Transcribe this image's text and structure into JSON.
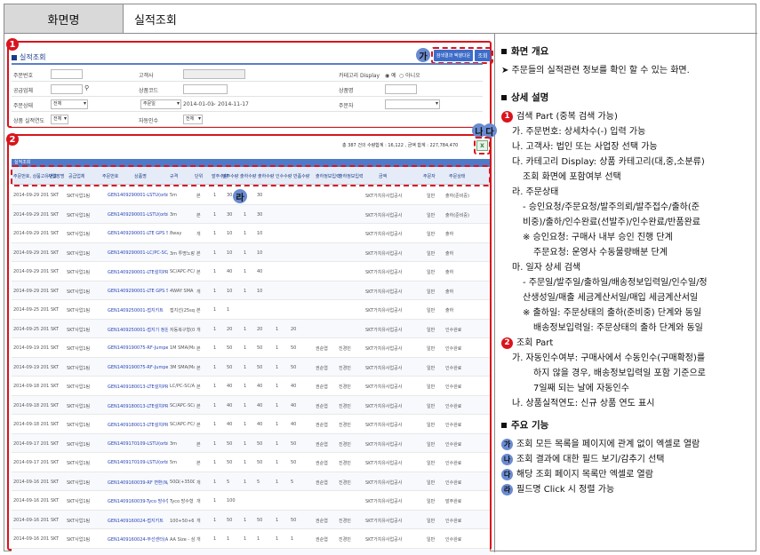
{
  "header": {
    "label": "화면명",
    "title": "실적조회"
  },
  "search": {
    "title": "실적조회",
    "excel_button": "검색결과 엑셀다운",
    "search_button": "조회",
    "fields": {
      "order_no": "주문번호",
      "customer": "고객사",
      "category_display": "카테고리 Display",
      "category_opt_yes": "예",
      "category_opt_no": "아니오",
      "supplier": "공급업체",
      "product_code": "상품코드",
      "product_name": "상품명",
      "order_status": "주문상태",
      "order_status_value": "전체",
      "date_type_value": "주문일",
      "date_from": "2014-01-01",
      "date_to": "2014-11-17",
      "orderer": "주문자",
      "product_year": "상품 실적연도",
      "product_year_value": "전체",
      "auto_receipt": "자동인수",
      "auto_receipt_value": "전체"
    },
    "result_summary": "총 387 건의 수량합계 : 16,122 , 금액 합계 : 227,784,470"
  },
  "grid": {
    "title": "실적조회",
    "columns": [
      "주문번호, 상품고유번호",
      "사업장명",
      "공급업체",
      "주문번호",
      "상품명",
      "규격",
      "단위",
      "발주수량",
      "발주수량",
      "출하수량",
      "출하수량",
      "인수수량",
      "반품수량",
      "출하정보입력",
      "출하정보입력",
      "금액",
      "주문자",
      "주문상태"
    ],
    "rows": [
      {
        "date": "2014-09-29 2014-10-04",
        "site": "SKT",
        "sup": "SKT사업1팀",
        "code": "GEN1409290001-LSTU(orbit)DLC L",
        "name": "5m",
        "unit": "본",
        "q1": "1",
        "q2": "30",
        "q3": "1",
        "q4": "30",
        "q5": "",
        "q6": "",
        "d1": "",
        "d2": "",
        "amt": "SKT가치유사업공사",
        "user": "일반",
        "st": "출하(준비중)"
      },
      {
        "date": "2014-09-29 2014-10-04",
        "site": "SKT",
        "sup": "SKT사업1팀",
        "code": "GEN1409290001-LSTU(orbit)DLC L",
        "name": "3m",
        "unit": "본",
        "q1": "1",
        "q2": "30",
        "q3": "1",
        "q4": "30",
        "q5": "",
        "q6": "",
        "d1": "",
        "d2": "",
        "amt": "SKT가치유사업공사",
        "user": "일반",
        "st": "출하(준비중)"
      },
      {
        "date": "2014-09-29 2014-10-04",
        "site": "SKT",
        "sup": "SKT사업1팀",
        "code": "GEN1409290001-LTE GPS Splitter",
        "name": "8way",
        "unit": "개",
        "q1": "1",
        "q2": "10",
        "q3": "1",
        "q4": "10",
        "q5": "",
        "q6": "",
        "d1": "",
        "d2": "",
        "amt": "SKT가치유사업공사",
        "user": "일반",
        "st": "출하"
      },
      {
        "date": "2014-09-29 2014-10-04",
        "site": "SKT",
        "sup": "SKT사업1팀",
        "code": "GEN1409290001-LC/PC-SC/APC",
        "name": "3m 투명노랑색",
        "unit": "본",
        "q1": "1",
        "q2": "10",
        "q3": "1",
        "q4": "10",
        "q5": "",
        "q6": "",
        "d1": "",
        "d2": "",
        "amt": "SKT가치유사업공사",
        "user": "일반",
        "st": "출하"
      },
      {
        "date": "2014-09-29 2014-10-04",
        "site": "SKT",
        "sup": "SKT사업1팀",
        "code": "GEN1409290001-LTE설치PR수료",
        "name": "SC/APC-FC/APC",
        "unit": "본",
        "q1": "1",
        "q2": "40",
        "q3": "1",
        "q4": "40",
        "q5": "",
        "q6": "",
        "d1": "",
        "d2": "",
        "amt": "SKT가치유사업공사",
        "user": "일반",
        "st": "출하"
      },
      {
        "date": "2014-09-29 2014-10-04",
        "site": "SKT",
        "sup": "SKT사업1팀",
        "code": "GEN1409290001-LTE GPS SPLITTER",
        "name": "4WAY SMA TYPE",
        "unit": "개",
        "q1": "1",
        "q2": "10",
        "q3": "1",
        "q4": "10",
        "q5": "",
        "q6": "",
        "d1": "",
        "d2": "",
        "amt": "SKT가치유사업공사",
        "user": "일반",
        "st": "출하"
      },
      {
        "date": "2014-09-25 2014-09-25",
        "site": "SKT",
        "sup": "SKT사업1팀",
        "code": "GEN1409250001-접지키트",
        "name": "접지선(25sq)",
        "unit": "본",
        "q1": "1",
        "q2": "1",
        "q3": "",
        "q4": "",
        "q5": "",
        "q6": "",
        "d1": "",
        "d2": "",
        "amt": "SKT가치유사업공사",
        "user": "일반",
        "st": "출하"
      },
      {
        "date": "2014-09-25 2014-09-25",
        "site": "SKT",
        "sup": "SKT사업1팀",
        "code": "GEN1409250001-접지기 정원판",
        "name": "자동복구형(0.4)",
        "unit": "개",
        "q1": "1",
        "q2": "20",
        "q3": "1",
        "q4": "20",
        "q5": "1",
        "q6": "20",
        "d1": "",
        "d2": "",
        "amt": "SKT가치유사업공사",
        "user": "일반",
        "st": "인수완료"
      },
      {
        "date": "2014-09-19 2014-09-22",
        "site": "SKT",
        "sup": "SKT사업1팀",
        "code": "GEN1409190075-RF-Jumper",
        "name": "1M SMA(Male)-SMA",
        "unit": "본",
        "q1": "1",
        "q2": "50",
        "q3": "1",
        "q4": "50",
        "q5": "1",
        "q6": "50",
        "d1": "권순엽",
        "d2": "진경민",
        "amt": "SKT가치유사업공사",
        "user": "일반",
        "st": "인수완료"
      },
      {
        "date": "2014-09-19 2014-09-22",
        "site": "SKT",
        "sup": "SKT사업1팀",
        "code": "GEN1409190075-RF-Jumper",
        "name": "3M SMA(Male)-SMA",
        "unit": "본",
        "q1": "1",
        "q2": "50",
        "q3": "1",
        "q4": "50",
        "q5": "1",
        "q6": "50",
        "d1": "권순엽",
        "d2": "진경민",
        "amt": "SKT가치유사업공사",
        "user": "일반",
        "st": "인수완료"
      },
      {
        "date": "2014-09-18 2014-09-23",
        "site": "SKT",
        "sup": "SKT사업1팀",
        "code": "GEN1409180013-LTE설치PR수료",
        "name": "LC/PC-SC/APC",
        "unit": "본",
        "q1": "1",
        "q2": "40",
        "q3": "1",
        "q4": "40",
        "q5": "1",
        "q6": "40",
        "d1": "권순엽",
        "d2": "진경민",
        "amt": "SKT가치유사업공사",
        "user": "일반",
        "st": "인수완료"
      },
      {
        "date": "2014-09-18 2014-09-23",
        "site": "SKT",
        "sup": "SKT사업1팀",
        "code": "GEN1409180013-LTE설치PR수료",
        "name": "SC/APC-SC/APC",
        "unit": "본",
        "q1": "1",
        "q2": "40",
        "q3": "1",
        "q4": "40",
        "q5": "1",
        "q6": "40",
        "d1": "권순엽",
        "d2": "진경민",
        "amt": "SKT가치유사업공사",
        "user": "일반",
        "st": "인수완료"
      },
      {
        "date": "2014-09-18 2014-09-23",
        "site": "SKT",
        "sup": "SKT사업1팀",
        "code": "GEN1409180013-LTE설치PR수료",
        "name": "SC/APC-FC/APC",
        "unit": "본",
        "q1": "1",
        "q2": "40",
        "q3": "1",
        "q4": "40",
        "q5": "1",
        "q6": "40",
        "d1": "권순엽",
        "d2": "진경민",
        "amt": "SKT가치유사업공사",
        "user": "일반",
        "st": "인수완료"
      },
      {
        "date": "2014-09-17 2014-09-22",
        "site": "SKT",
        "sup": "SKT사업1팀",
        "code": "GEN1409170109-LSTU(orbit)DLC L",
        "name": "3m",
        "unit": "본",
        "q1": "1",
        "q2": "50",
        "q3": "1",
        "q4": "50",
        "q5": "1",
        "q6": "50",
        "d1": "권순엽",
        "d2": "진경민",
        "amt": "SKT가치유사업공사",
        "user": "일반",
        "st": "인수완료"
      },
      {
        "date": "2014-09-17 2014-09-22",
        "site": "SKT",
        "sup": "SKT사업1팀",
        "code": "GEN1409170109-LSTU(orbit)DLC L",
        "name": "5m",
        "unit": "본",
        "q1": "1",
        "q2": "50",
        "q3": "1",
        "q4": "50",
        "q5": "1",
        "q6": "50",
        "d1": "권순엽",
        "d2": "진경민",
        "amt": "SKT가치유사업공사",
        "user": "일반",
        "st": "인수완료"
      },
      {
        "date": "2014-09-16 2014-09-22",
        "site": "SKT",
        "sup": "SKT사업1팀",
        "code": "GEN1409160039-RF 변환(N/TTS)M",
        "name": "50Ω(+350Ω)-N",
        "unit": "개",
        "q1": "1",
        "q2": "5",
        "q3": "1",
        "q4": "5",
        "q5": "1",
        "q6": "5",
        "d1": "권순엽",
        "d2": "진경민",
        "amt": "SKT가치유사업공사",
        "user": "일반",
        "st": "인수완료"
      },
      {
        "date": "2014-09-16 2014-09-19",
        "site": "SKT",
        "sup": "SKT사업1팀",
        "code": "GEN1409160039-Tyco 방수형 Kit",
        "name": "Tyco 방수형 Kit",
        "unit": "개",
        "q1": "1",
        "q2": "100",
        "q3": "",
        "q4": "",
        "q5": "",
        "q6": "",
        "d1": "",
        "d2": "",
        "amt": "SKT가치유사업공사",
        "user": "일반",
        "st": "발주완료"
      },
      {
        "date": "2014-09-16 2014-09-18",
        "site": "SKT",
        "sup": "SKT사업1팀",
        "code": "GEN1409160024-접지키트",
        "name": "100+50+6, 접지봉",
        "unit": "개",
        "q1": "1",
        "q2": "50",
        "q3": "1",
        "q4": "50",
        "q5": "1",
        "q6": "50",
        "d1": "권순엽",
        "d2": "진경민",
        "amt": "SKT가치유사업공사",
        "user": "일반",
        "st": "인수완료"
      },
      {
        "date": "2014-09-16 2014-09-18",
        "site": "SKT",
        "sup": "SKT사업1팀",
        "code": "GEN1409160024-무선센터(AA 배터",
        "name": "AA Size - 삼성용",
        "unit": "개",
        "q1": "1",
        "q2": "1",
        "q3": "1",
        "q4": "1",
        "q5": "1",
        "q6": "1",
        "d1": "권순엽",
        "d2": "진경민",
        "amt": "SKT가치유사업공사",
        "user": "일반",
        "st": "인수완료"
      },
      {
        "date": "2014-09-16 2014-09-17",
        "site": "SKT",
        "sup": "SKT사업1팀",
        "code": "GEN1409160024-접지키트",
        "name": "접지봉(25sq)",
        "unit": "개",
        "q1": "1",
        "q2": "10",
        "q3": "1",
        "q4": "10",
        "q5": "1",
        "q6": "10",
        "d1": "권순엽",
        "d2": "진경민",
        "amt": "SKT가치유사업공사",
        "user": "일반",
        "st": "인수완료"
      }
    ]
  },
  "badges": {
    "one": "1",
    "two": "2",
    "ga": "가",
    "na": "나",
    "da": "다",
    "ra": "라"
  },
  "desc": {
    "overview_title": "화면 개요",
    "overview_text": "➤ 주문들의 실적관련 정보를 확인 할 수 있는 화면.",
    "detail_title": "상세 설명",
    "lines": [
      {
        "kind": "num",
        "badge": "1",
        "text": "검색 Part (중복 검색 가능)",
        "indent": 0
      },
      {
        "kind": "text",
        "text": "가. 주문번호: 상세차수(-) 입력 가능",
        "indent": 1
      },
      {
        "kind": "text",
        "text": "나. 고객사: 법인 또는 사업장 선택 가능",
        "indent": 1
      },
      {
        "kind": "text",
        "text": "다. 카테고리 Display: 상품 카테고리(대,중,소분류)",
        "indent": 1
      },
      {
        "kind": "text",
        "text": "조회 화면에 포함여부 선택",
        "indent": 2
      },
      {
        "kind": "text",
        "text": "라. 주문상태",
        "indent": 1
      },
      {
        "kind": "text",
        "text": "- 승인요청/주문요청/발주의뢰/발주접수/출하(준",
        "indent": 2
      },
      {
        "kind": "text",
        "text": "비중)/출하/인수완료(선발주)/인수완료/반품완료",
        "indent": 2
      },
      {
        "kind": "text",
        "text": "※ 승인요청: 구매사 내부 승인 진행 단계",
        "indent": 2
      },
      {
        "kind": "text",
        "text": "주문요청: 운영사 수동물량배분 단계",
        "indent": 3
      },
      {
        "kind": "text",
        "text": "마. 일자 상세 검색",
        "indent": 1
      },
      {
        "kind": "text",
        "text": "- 주문일/발주일/출하일/배송정보입력일/인수일/정",
        "indent": 2
      },
      {
        "kind": "text",
        "text": "산생성일/매출 세금계산서일/매입 세금계산서일",
        "indent": 2
      },
      {
        "kind": "text",
        "text": "※ 출하일: 주문상태의 출하(준비중) 단계와 동일",
        "indent": 2
      },
      {
        "kind": "text",
        "text": "배송정보입력일: 주문상태의 출하 단계와 동일",
        "indent": 3
      },
      {
        "kind": "num",
        "badge": "2",
        "text": "조회 Part",
        "indent": 0
      },
      {
        "kind": "text",
        "text": "가. 자동인수여부: 구매사에서 수동인수(구매확정)를",
        "indent": 1
      },
      {
        "kind": "text",
        "text": "하지 않을 경우, 배송정보입력일 포함 기준으로",
        "indent": 3
      },
      {
        "kind": "text",
        "text": "7일째 되는 날에 자동인수",
        "indent": 3
      },
      {
        "kind": "text",
        "text": "나. 상품실적연도: 신규 상품 연도 표시",
        "indent": 1
      }
    ],
    "feature_title": "주요 기능",
    "features": [
      {
        "badge": "가",
        "text": "조회 모든 목록을 페이지에 관계 없이 엑셀로 열람"
      },
      {
        "badge": "나",
        "text": "조회 결과에 대한 필드 보기/감추기 선택"
      },
      {
        "badge": "다",
        "text": "해당 조회 페이지 목록만 엑셀로 열람"
      },
      {
        "badge": "라",
        "text": "필드명 Click 시 정렬 가능"
      }
    ]
  }
}
